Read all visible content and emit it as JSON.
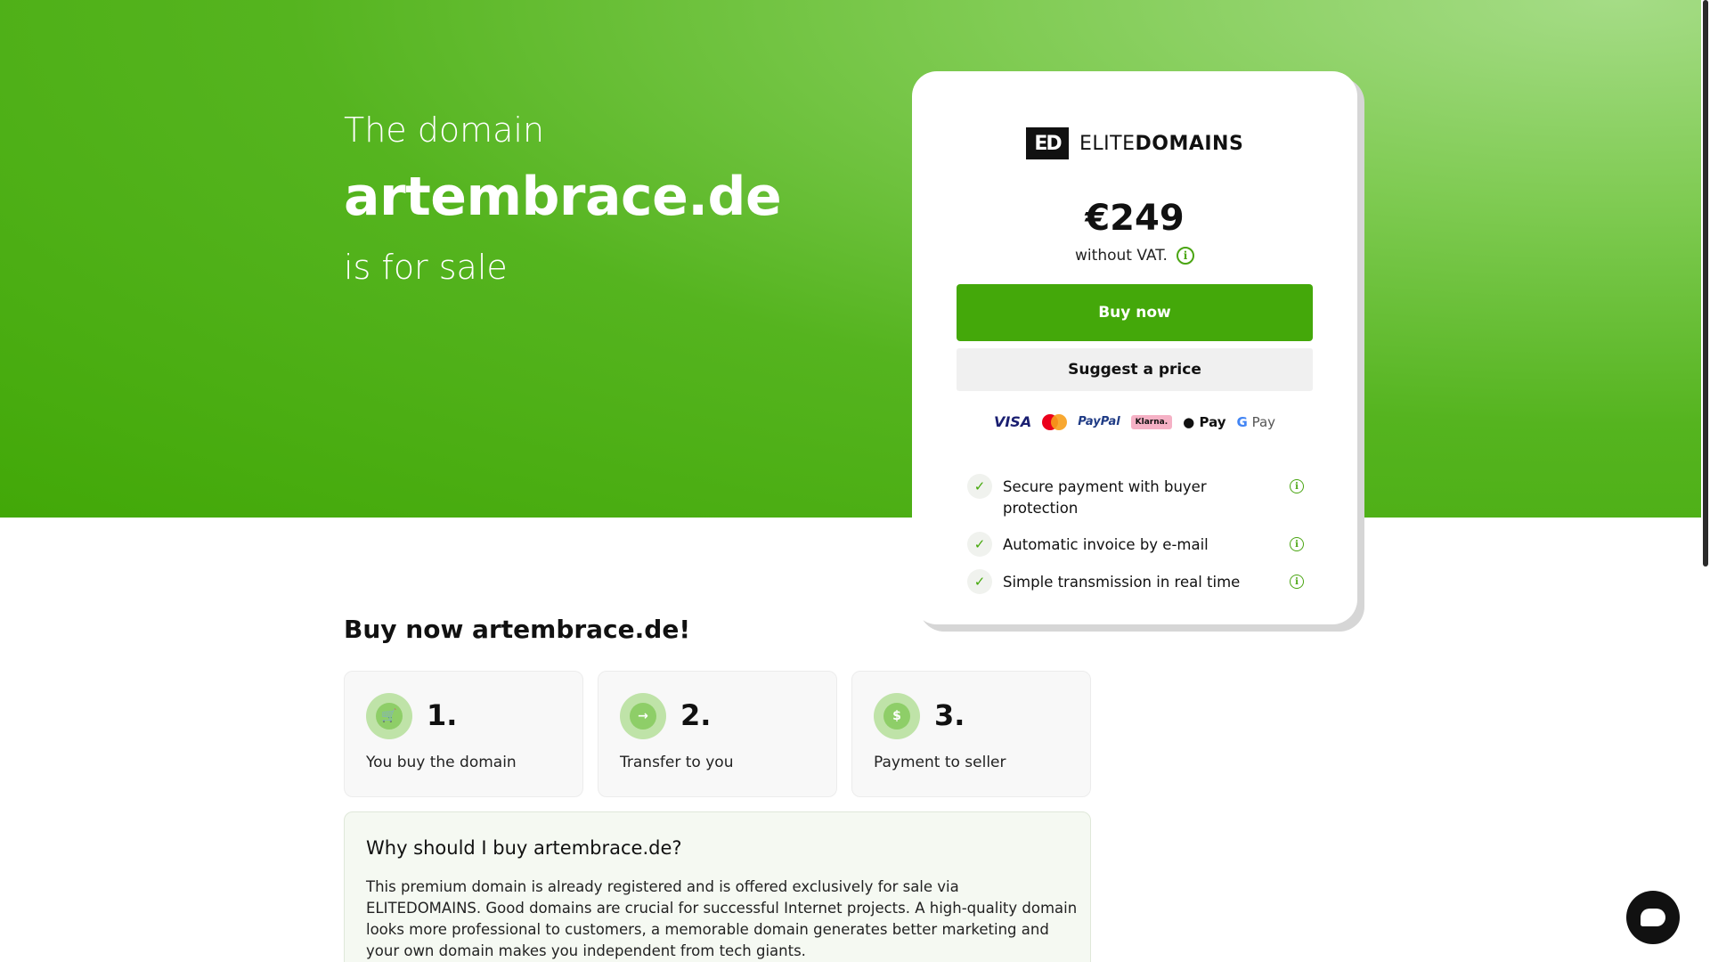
{
  "hero": {
    "pre": "The domain",
    "domain": "artembrace.de",
    "post": "is for sale"
  },
  "card": {
    "logo_mark": "ED",
    "logo_text_light": "ELITE",
    "logo_text_bold": "DOMAINS",
    "price": "€249",
    "vat": "without VAT.",
    "buy_label": "Buy now",
    "suggest_label": "Suggest a price",
    "payments": {
      "visa": "VISA",
      "paypal": "PayPal",
      "klarna": "Klarna.",
      "applepay": " Pay",
      "gpay_g": "G",
      "gpay_text": " Pay"
    },
    "features": [
      {
        "label": "Secure payment with buyer protection"
      },
      {
        "label": "Automatic invoice by e-mail"
      },
      {
        "label": "Simple transmission in real time"
      }
    ]
  },
  "section": {
    "title": "Buy now artembrace.de!"
  },
  "steps": [
    {
      "num": "1.",
      "label": "You buy the domain",
      "icon": "cart-icon"
    },
    {
      "num": "2.",
      "label": "Transfer to you",
      "icon": "arrow-right-icon"
    },
    {
      "num": "3.",
      "label": "Payment to seller",
      "icon": "dollar-icon"
    }
  ],
  "why": {
    "title": "Why should I buy artembrace.de?",
    "body": "This premium domain is already registered and is offered exclusively for sale via ELITEDOMAINS. Good domains are crucial for successful Internet projects. A high-quality domain looks more professional to customers, a memorable domain generates better marketing and your own domain makes you independent from tech giants."
  },
  "colors": {
    "accent": "#44a80a",
    "hero_light": "#a5dc86"
  }
}
